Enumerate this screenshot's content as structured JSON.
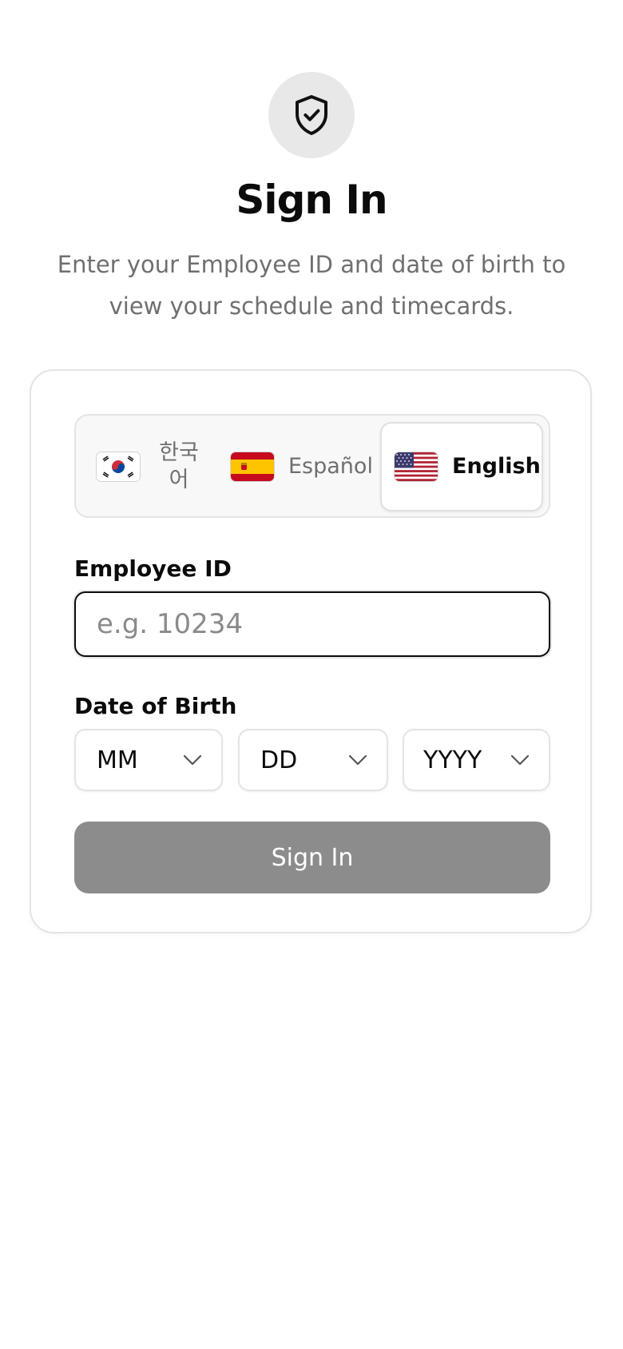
{
  "header": {
    "icon": "shield-check-icon",
    "title": "Sign In",
    "subtitle": "Enter your Employee ID and date of birth to view your schedule and timecards."
  },
  "language_switcher": {
    "selected": "English",
    "options": [
      {
        "label": "한국어",
        "flag": "korea-flag-icon"
      },
      {
        "label": "Español",
        "flag": "spain-flag-icon"
      },
      {
        "label": "English",
        "flag": "usa-flag-icon"
      }
    ]
  },
  "form": {
    "employee_id": {
      "label": "Employee ID",
      "placeholder": "e.g. 10234",
      "value": ""
    },
    "dob": {
      "label": "Date of Birth",
      "month": "MM",
      "day": "DD",
      "year": "YYYY"
    },
    "submit_label": "Sign In"
  },
  "colors": {
    "icon_circle": "#e8e8e8",
    "button_disabled": "#8c8c8c",
    "border": "#e4e4e4",
    "text_muted": "#6f6f6f"
  }
}
